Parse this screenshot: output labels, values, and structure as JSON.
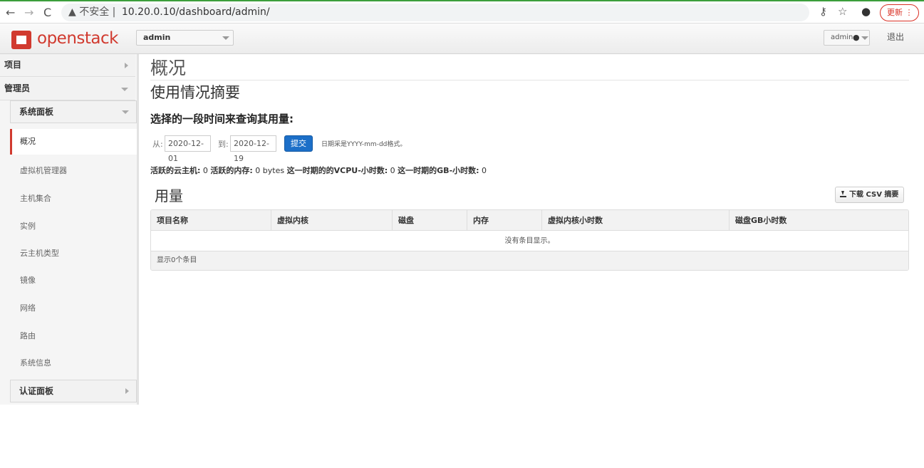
{
  "browser": {
    "back": "←",
    "forward": "→",
    "reload": "C",
    "warning_icon": "▲",
    "insecure_label": "不安全 |",
    "url": "10.20.0.10/dashboard/admin/",
    "key_icon": "⚷",
    "star_icon": "☆",
    "profile_icon": "●",
    "update_label": "更新 ⋮"
  },
  "header": {
    "logo_text": "openstack",
    "project": "admin",
    "user": "admin",
    "logout": "退出"
  },
  "sidebar": {
    "project": "项目",
    "admin": "管理员",
    "system_panel": "系统面板",
    "items": [
      "概况",
      "虚拟机管理器",
      "主机集合",
      "实例",
      "云主机类型",
      "镜像",
      "网络",
      "路由",
      "系统信息"
    ],
    "auth_panel": "认证面板"
  },
  "main": {
    "page_title": "概况",
    "section_title": "使用情况摘要",
    "query_title": "选择的一段时间来查询其用量:",
    "from_label": "从:",
    "from_value": "2020-12-01",
    "to_label": "到:",
    "to_value": "2020-12-19",
    "submit": "提交",
    "date_hint": "日期采是YYYY-mm-dd格式。",
    "stats": {
      "active_instances_label": "活跃的云主机:",
      "active_instances_value": " 0 ",
      "active_memory_label": "活跃的内存:",
      "active_memory_value": " 0 bytes ",
      "vcpu_hours_label": "这一时期的的VCPU-小时数:",
      "vcpu_hours_value": " 0 ",
      "gb_hours_label": "这一时期的GB-小时数:",
      "gb_hours_value": " 0"
    },
    "usage_title": "用量",
    "csv_button": "下载 CSV 摘要",
    "table": {
      "headers": [
        "项目名称",
        "虚拟内核",
        "磁盘",
        "内存",
        "虚拟内核小时数",
        "磁盘GB小时数"
      ],
      "empty": "没有条目显示。",
      "footer": "显示0个条目"
    }
  }
}
